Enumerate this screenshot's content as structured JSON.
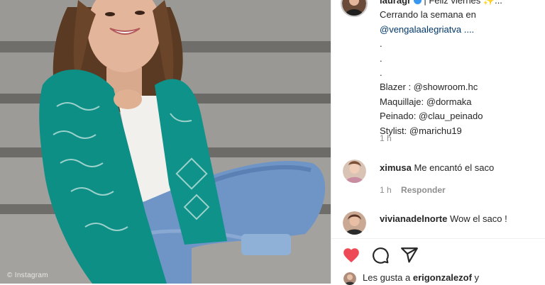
{
  "post": {
    "caption_head_user": "lauragr",
    "caption_head_rest": "| Feliz viernes ✨...",
    "caption_lines": [
      "Cerrando la semana en",
      "@vengalaalegriatva ....",
      ".",
      ".",
      ".",
      "Blazer : @showroom.hc",
      "Maquillaje: @dormaka",
      "Peinado: @clau_peinado",
      "Stylist: @marichu19"
    ],
    "time": "1 h"
  },
  "photo": {
    "watermark": "© Instagram"
  },
  "comments": [
    {
      "user": "ximusa",
      "text": "Me encantó el saco",
      "time": "1 h",
      "reply": "Responder"
    },
    {
      "user": "vivianadelnorte",
      "text": "Wow el saco !"
    }
  ],
  "actions": {
    "like_icon": "heart-filled-icon",
    "comment_icon": "comment-icon",
    "share_icon": "paper-plane-icon",
    "like_color": "#ed4956"
  },
  "likes": {
    "prefix": "Les gusta a",
    "user": "erigonzalezof",
    "suffix": "y"
  }
}
